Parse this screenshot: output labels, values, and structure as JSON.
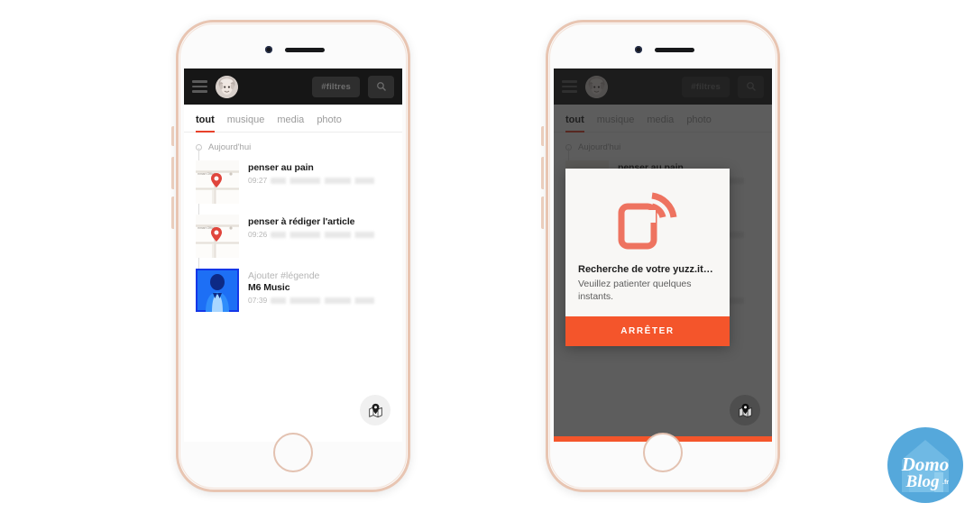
{
  "app": {
    "header": {
      "menu_icon": "hamburger-icon",
      "avatar_icon": "user-avatar",
      "filters_label": "#filtres",
      "search_icon": "search-icon"
    },
    "tabs": [
      {
        "label": "tout",
        "active": true
      },
      {
        "label": "musique",
        "active": false
      },
      {
        "label": "media",
        "active": false
      },
      {
        "label": "photo",
        "active": false
      }
    ],
    "timeline": {
      "day_label": "Aujourd'hui",
      "items": [
        {
          "pretitle": "",
          "title": "penser au pain",
          "time": "09:27",
          "thumb": "map-thumbnail"
        },
        {
          "pretitle": "",
          "title": "penser à rédiger l'article",
          "time": "09:26",
          "thumb": "map-thumbnail"
        },
        {
          "pretitle": "Ajouter #légende",
          "title": "M6 Music",
          "time": "07:39",
          "thumb": "photo-thumbnail"
        }
      ]
    },
    "fab_icon": "map-pin-icon"
  },
  "modal": {
    "icon": "phone-wifi-icon",
    "title": "Recherche de votre yuzz.it…",
    "subtitle": "Veuillez patienter quelques instants.",
    "button_label": "ARRÊTER"
  },
  "watermark": {
    "name": "domo-blog-logo",
    "line1": "Domo",
    "line2": "Blog",
    "suffix": ".fr"
  },
  "colors": {
    "accent_orange": "#f4552b",
    "tab_underline": "#e8412a",
    "icon_salmon": "#ee7360",
    "header_dark": "#161616",
    "frame_rose_gold": "#e8c5b2",
    "watermark_blue": "#55a8db"
  }
}
